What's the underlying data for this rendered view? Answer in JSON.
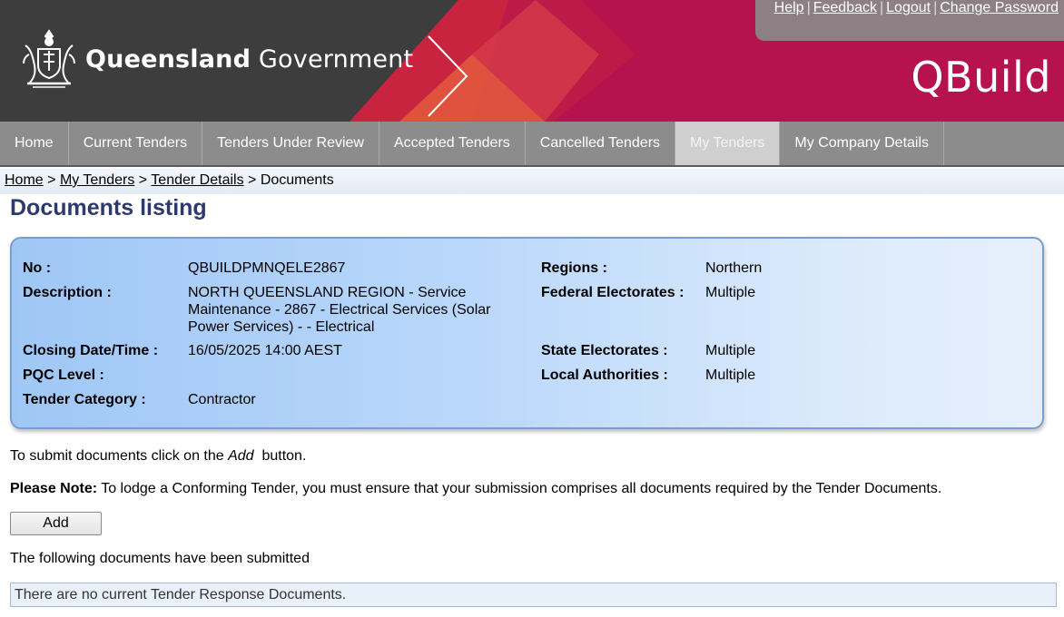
{
  "header": {
    "logo_bold": "Queensland",
    "logo_regular": "Government",
    "app_name": "QBuild",
    "links": [
      "Help",
      "Feedback",
      "Logout",
      "Change Password"
    ],
    "colors": {
      "dark": "#3d3d3d",
      "brand": "#b5124e",
      "accent": "#e0524a"
    }
  },
  "nav": {
    "items": [
      "Home",
      "Current Tenders",
      "Tenders Under Review",
      "Accepted Tenders",
      "Cancelled Tenders",
      "My Tenders",
      "My Company Details"
    ],
    "active": "My Tenders"
  },
  "breadcrumb": {
    "links": [
      "Home",
      "My Tenders",
      "Tender Details"
    ],
    "current": "Documents",
    "separator": ">"
  },
  "page_title": "Documents listing",
  "tender": {
    "no_label": "No :",
    "no_value": "QBUILDPMNQELE2867",
    "description_label": "Description :",
    "description_value": "NORTH QUEENSLAND REGION - Service Maintenance - 2867 - Electrical Services (Solar Power Services) - - Electrical",
    "closing_label": "Closing Date/Time :",
    "closing_value": "16/05/2025 14:00 AEST",
    "pqc_label": "PQC Level :",
    "pqc_value": "",
    "category_label": "Tender Category :",
    "category_value": "Contractor",
    "regions_label": "Regions :",
    "regions_value": "Northern",
    "federal_label": "Federal Electorates :",
    "federal_value": "Multiple",
    "state_label": "State Electorates :",
    "state_value": "Multiple",
    "local_label": "Local Authorities :",
    "local_value": "Multiple"
  },
  "instructions": {
    "submit_prefix": "To submit documents click on the ",
    "submit_em": "Add",
    "submit_suffix": "  button.",
    "note_label": "Please Note:",
    "note_text": " To lodge a Conforming Tender, you must ensure that your submission comprises all documents required by the Tender Documents."
  },
  "add_button_label": "Add",
  "submitted_heading": "The following documents have been submitted",
  "empty_message": "There are no current Tender Response Documents."
}
